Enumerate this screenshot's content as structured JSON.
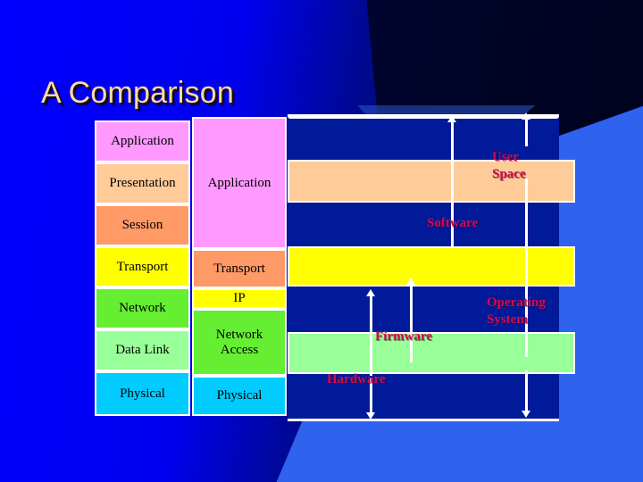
{
  "slide": {
    "title": "A Comparison",
    "title_color": "#ffd9a8",
    "background_color": "#0000ff",
    "accent_color": "#2f62ef"
  },
  "diagram": {
    "type": "layered-stack-comparison",
    "osi_column": {
      "name": "OSI model stack",
      "layers": [
        {
          "label": "Application",
          "color": "#ff99ff"
        },
        {
          "label": "Presentation",
          "color": "#ffcc99"
        },
        {
          "label": "Session",
          "color": "#ff9966"
        },
        {
          "label": "Transport",
          "color": "#ffff00"
        },
        {
          "label": "Network",
          "color": "#66ee33"
        },
        {
          "label": "Data Link",
          "color": "#99ff99"
        },
        {
          "label": "Physical",
          "color": "#00ccff"
        }
      ]
    },
    "tcpip_column": {
      "name": "TCP/IP model stack",
      "layers": [
        {
          "label": "Application",
          "color": "#ff99ff"
        },
        {
          "label": "Transport",
          "color": "#ff9966"
        },
        {
          "label": "IP",
          "color": "#ffff00"
        },
        {
          "label": "Network\nAccess",
          "color": "#66ee33"
        },
        {
          "label": "Physical",
          "color": "#00ccff"
        }
      ]
    },
    "implementation_bands": [
      {
        "name": "band-application",
        "color": "#001a9a"
      },
      {
        "name": "band-presentation",
        "color": "#ffcc99"
      },
      {
        "name": "band-session",
        "color": "#001a9a"
      },
      {
        "name": "band-transport",
        "color": "#ffff00"
      },
      {
        "name": "band-network",
        "color": "#001a9a"
      },
      {
        "name": "band-datalink",
        "color": "#99ff99"
      },
      {
        "name": "band-physical",
        "color": "#001a9a"
      }
    ],
    "annotations": [
      {
        "name": "user-space",
        "text": "User\nSpace",
        "color": "#d40a4e"
      },
      {
        "name": "software",
        "text": "Software",
        "color": "#d40a4e"
      },
      {
        "name": "operating-system",
        "text": "Operating\nSystem",
        "color": "#d40a4e"
      },
      {
        "name": "firmware",
        "text": "Firmware",
        "color": "#d40a4e"
      },
      {
        "name": "hardware",
        "text": "Hardware",
        "color": "#d40a4e"
      }
    ]
  }
}
